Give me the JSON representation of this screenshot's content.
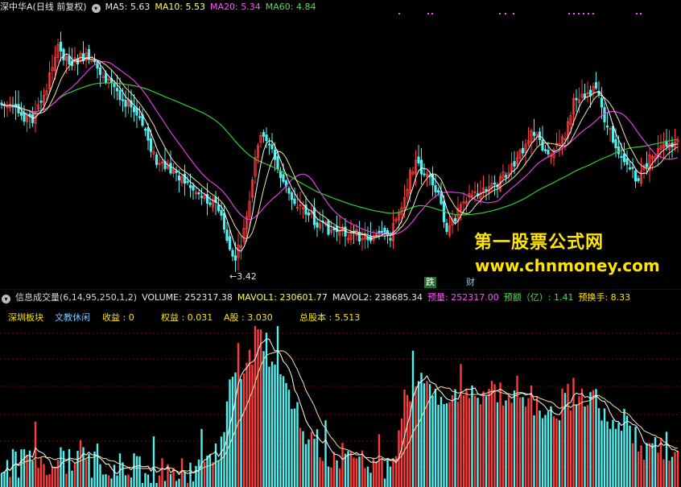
{
  "chart_header": {
    "stock_title": "深中华A(日线 前复权)",
    "ma5_label": "MA5: 5.63",
    "ma10_label": "MA10: 5.53",
    "ma20_label": "MA20: 5.34",
    "ma60_label": "MA60: 4.84"
  },
  "colors": {
    "up": "#ff3b3b",
    "down": "#54f0f0",
    "ma5": "#ffffff",
    "ma10": "#f2e6a6",
    "ma20": "#e040e0",
    "ma60": "#33cc33",
    "ma5_label": "#e8e8e8",
    "ma10_label": "#ffff60",
    "ma20_label": "#ff55ff",
    "ma60_label": "#55dd55",
    "yellow": "#ffe600",
    "mavol2_label": "#e8e8e8",
    "yuliang": "#ff55ff",
    "yue": "#55dd55",
    "huanshou": "#ffe600"
  },
  "price_chart": {
    "min_price_label": "3.42",
    "watermark_line1": "第一股票公式网",
    "watermark_line2": "www.chnmoney.com",
    "tag_die": "跌",
    "tag_cai": "财"
  },
  "volume_header": {
    "indicator": "信息成交量(6,14,95,250,1,2)",
    "volume": "VOLUME: 252317.38",
    "mavol1": "MAVOL1: 230601.77",
    "mavol2": "MAVOL2: 238685.34",
    "yuliang": "预量: 252317.00",
    "yue": "预额（亿）: 1.41",
    "huanshou": "预换手: 8.33"
  },
  "stock_info": {
    "board": "深圳板块",
    "industry": "文教休闲",
    "shouyi": "收益 : 0",
    "quanyi": "权益 : 0.031",
    "agu": "A股 : 3.030",
    "zongguben": "总股本 : 5.513"
  },
  "icons": {
    "header_toggle": "chevron-icon",
    "volume_toggle": "chevron-icon"
  }
}
